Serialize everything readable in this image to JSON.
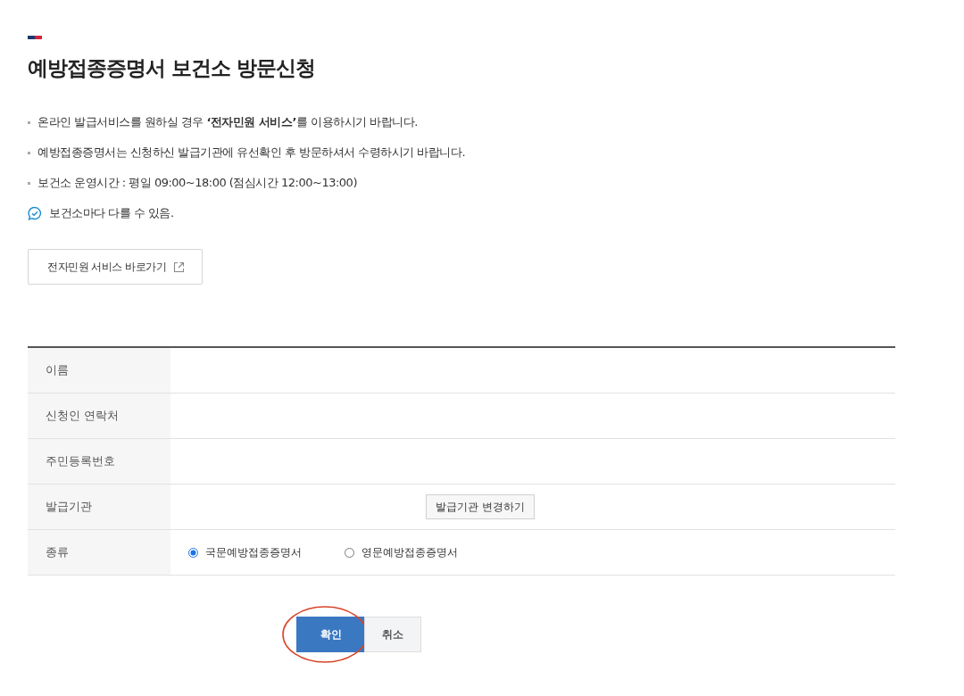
{
  "title": "예방접종증명서 보건소 방문신청",
  "notices": [
    "온라인 발급서비스를 원하실 경우 **‘전자민원 서비스’**를 이용하시기 바랍니다.",
    "예방접종증명서는 신청하신 발급기관에 유선확인 후 방문하셔서 수령하시기 바랍니다.",
    "보건소 운영시간 : 평일 09:00~18:00 (점심시간 12:00~13:00)"
  ],
  "note": "보건소마다 다를 수 있음.",
  "link_button": "전자민원 서비스 바로가기",
  "form_rows": [
    {
      "kind": "empty",
      "label": "이름"
    },
    {
      "kind": "empty",
      "label": "신청인 연락처"
    },
    {
      "kind": "empty",
      "label": "주민등록번호"
    },
    {
      "kind": "button",
      "label": "발급기관",
      "button": "발급기관 변경하기"
    },
    {
      "kind": "radio",
      "label": "종류",
      "options": [
        {
          "label": "국문예방접종증명서",
          "selected": true
        },
        {
          "label": "영문예방접종증명서",
          "selected": false
        }
      ]
    }
  ],
  "actions": [
    {
      "label": "확인",
      "kind": "primary",
      "highlighted": true
    },
    {
      "label": "취소",
      "kind": "secondary",
      "highlighted": false
    }
  ]
}
